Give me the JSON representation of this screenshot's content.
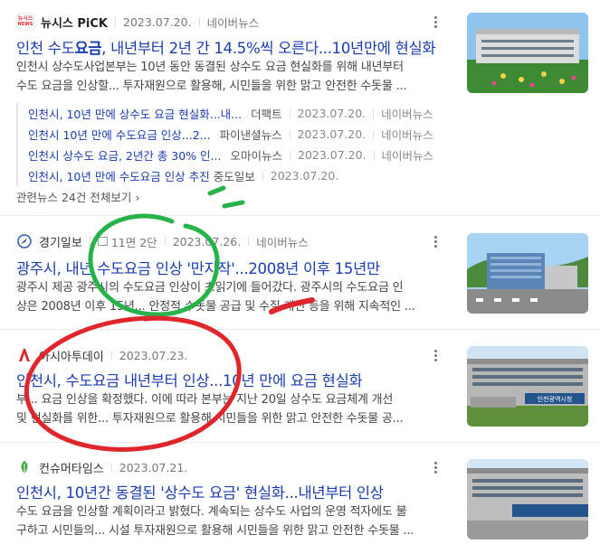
{
  "results": [
    {
      "press": "뉴시스 PiCK",
      "logo_text": "뉴시스",
      "logo_color": "#e0262d",
      "date": "2023.07.20.",
      "portal": "네이버뉴스",
      "title_parts": [
        "인천 수도",
        "요금",
        ", 내년부터 2년 간 14.5%씩 오른다...10년만에 현실화"
      ],
      "desc_line1": "인천시 상수도사업본부는 10년 동안 동결된 상수도 요금 현실화를 위해 내년부터",
      "desc_line2": "수도 요금을 인상할... 투자재원으로 활용해, 시민들을 위한 맑고 안전한 수돗물 ...",
      "related": [
        {
          "title": "인천시, 10년 만에 상수도 요금 현실화...내...",
          "press": "더팩트",
          "date": "2023.07.20.",
          "portal": "네이버뉴스"
        },
        {
          "title": "인천시 10년 만에 수도요금 인상...2...",
          "press": "파이낸셜뉴스",
          "date": "2023.07.20.",
          "portal": "네이버뉴스"
        },
        {
          "title": "인천시 상수도 요금, 2년간 총 30% 인...",
          "press": "오마이뉴스",
          "date": "2023.07.20.",
          "portal": "네이버뉴스"
        },
        {
          "title": "인천시, 10년 만에 수도요금 인상 추진",
          "press": "중도일보",
          "date": "2023.07.20.",
          "portal": ""
        }
      ],
      "all_link": "관련뉴스 24건 전체보기 ›"
    },
    {
      "press": "경기일보",
      "page": "11면 2단",
      "date": "2023.07.26.",
      "portal": "네이버뉴스",
      "title": "광주시, 내년 수도요금 인상 '만지작'...2008년 이후 15년만",
      "desc_line1": "광주시 제공 광주시의 수도요금 인상이 초읽기에 들어갔다. 광주시의 수도요금 인",
      "desc_line2": "상은 2008년 이후 15년... 안정적 수돗물 공급 및 수질 개선 등을 위해 지속적인 ..."
    },
    {
      "press": "아시아투데이",
      "date": "2023.07.23.",
      "title": "인천시, 수도요금 내년부터 인상...10년 만에 요금 현실화",
      "desc_line1": "부... 요금 인상을 확정했다. 이에 따라 본부는 지난 20일 상수도 요금체계 개선",
      "desc_line2": "및 현실화를 위한... 투자재원으로 활용해 시민들을 위한 맑고 안전한 수돗물 공..."
    },
    {
      "press": "컨슈머타임스",
      "date": "2023.07.21.",
      "title": "인천시, 10년간 동결된 '상수도 요금' 현실화...내년부터 인상",
      "desc_line1": "수도 요금을 인상할 계획이라고 밝혔다. 계속되는 상수도 사업의 운영 적자에도 불",
      "desc_line2": "구하고 시민들의... 시설 투자재원으로 활용해 시민들을 위한 맑고 안전한 수돗물 ..."
    }
  ],
  "thumb_sign": "인천광역시청"
}
